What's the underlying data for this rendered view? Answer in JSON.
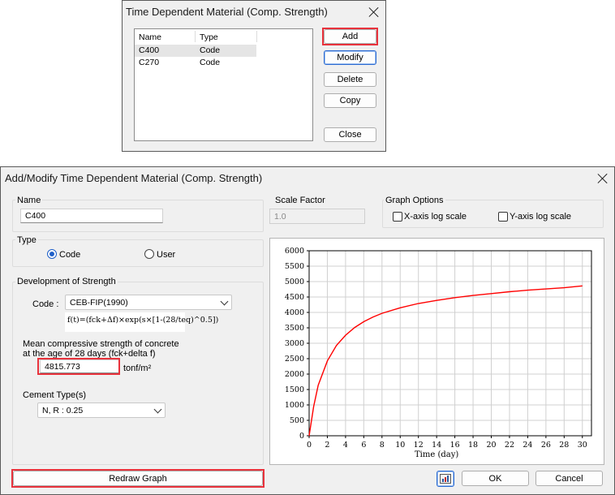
{
  "list_dialog": {
    "title": "Time Dependent Material (Comp. Strength)",
    "columns": [
      "Name",
      "Type"
    ],
    "rows": [
      {
        "name": "C400",
        "type": "Code"
      },
      {
        "name": "C270",
        "type": "Code"
      }
    ],
    "buttons": {
      "add": "Add",
      "modify": "Modify",
      "delete": "Delete",
      "copy": "Copy",
      "close": "Close"
    }
  },
  "edit_dialog": {
    "title": "Add/Modify Time Dependent Material (Comp. Strength)",
    "name_label": "Name",
    "name_value": "C400",
    "scale_label": "Scale Factor",
    "scale_value": "1.0",
    "graph_options_label": "Graph Options",
    "x_log_label": "X-axis log scale",
    "y_log_label": "Y-axis log scale",
    "type_label": "Type",
    "type_code": "Code",
    "type_user": "User",
    "dev_label": "Development of Strength",
    "code_label": "Code :",
    "code_value": "CEB-FIP(1990)",
    "formula": "f(t)=(fck+Δf)×exp(s×[1-(28/teq)^0.5])",
    "mean_label_1": "Mean compressive strength of concrete",
    "mean_label_2": "at the age of 28 days (fck+delta  f)",
    "mean_value": "4815.773",
    "mean_unit": "tonf/m²",
    "cement_label": "Cement Type(s)",
    "cement_value": "N, R : 0.25",
    "redraw": "Redraw Graph",
    "ok": "OK",
    "cancel": "Cancel"
  },
  "chart_data": {
    "type": "line",
    "xlabel": "Time (day)",
    "ylabel": "",
    "xlim": [
      0,
      31
    ],
    "ylim": [
      0,
      6000
    ],
    "x_ticks": [
      0,
      2,
      4,
      6,
      8,
      10,
      12,
      14,
      16,
      18,
      20,
      22,
      24,
      26,
      28,
      30
    ],
    "y_ticks": [
      0,
      500,
      1000,
      1500,
      2000,
      2500,
      3000,
      3500,
      4000,
      4500,
      5000,
      5500,
      6000
    ],
    "grid": true,
    "line_color": "#ff0000",
    "x": [
      0,
      0.5,
      1,
      2,
      3,
      4,
      5,
      6,
      7,
      8,
      10,
      12,
      14,
      16,
      18,
      20,
      22,
      24,
      26,
      28,
      30
    ],
    "y": [
      0,
      950,
      1640,
      2430,
      2930,
      3260,
      3510,
      3700,
      3850,
      3970,
      4150,
      4290,
      4390,
      4480,
      4550,
      4610,
      4670,
      4720,
      4760,
      4800,
      4860
    ]
  }
}
